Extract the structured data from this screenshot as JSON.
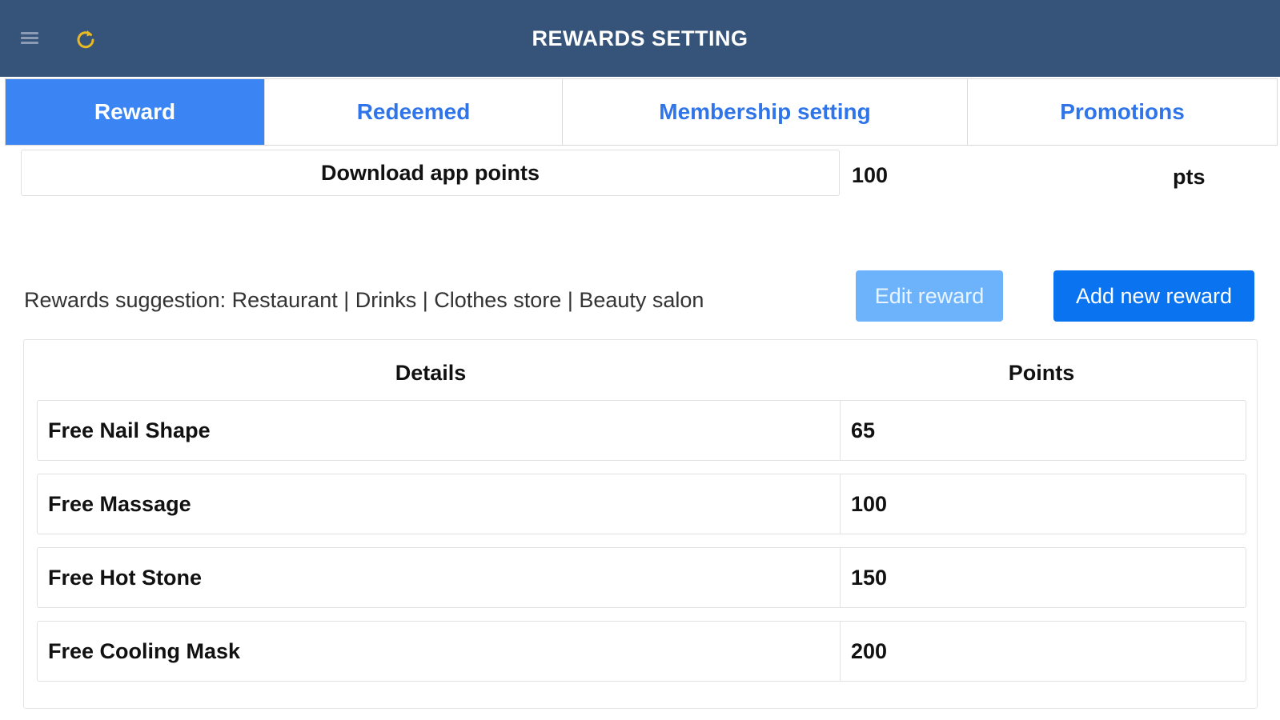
{
  "header": {
    "title": "REWARDS SETTING",
    "menu_icon": "hamburger-menu-icon",
    "refresh_icon": "refresh-icon",
    "refresh_color": "#e8b923",
    "background": "#36537a"
  },
  "tabs": [
    {
      "label": "Reward",
      "active": true
    },
    {
      "label": "Redeemed",
      "active": false
    },
    {
      "label": "Membership setting",
      "active": false
    },
    {
      "label": "Promotions",
      "active": false
    }
  ],
  "download_points": {
    "label": "Download app points",
    "value": "100",
    "unit": "pts"
  },
  "suggestion_text": "Rewards suggestion: Restaurant | Drinks | Clothes store | Beauty salon",
  "buttons": {
    "edit_reward": "Edit reward",
    "add_new_reward": "Add new reward"
  },
  "table": {
    "headers": {
      "details": "Details",
      "points": "Points"
    },
    "rows": [
      {
        "details": "Free Nail Shape",
        "points": "65"
      },
      {
        "details": "Free Massage",
        "points": "100"
      },
      {
        "details": "Free Hot Stone",
        "points": "150"
      },
      {
        "details": "Free Cooling Mask",
        "points": "200"
      }
    ]
  },
  "colors": {
    "accent": "#3a85f3",
    "primary_button": "#0a73f0",
    "secondary_button": "#6db3fb",
    "tab_text": "#2f74e8"
  }
}
